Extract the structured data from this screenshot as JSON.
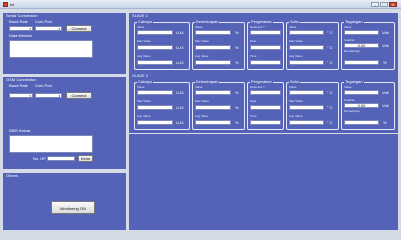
{
  "window": {
    "title": "txt",
    "btn_min": "–",
    "btn_max": "□",
    "btn_close": "x"
  },
  "serial": {
    "title": "Serial Connection",
    "baud_label": "Baud Rate",
    "com_label": "Com Port",
    "connect": "Connect",
    "data_label": "Data Mentah"
  },
  "gsm": {
    "title": "GSM Connection",
    "baud_label": "Baud Rate",
    "com_label": "Com Port",
    "connect": "Connect",
    "sms_label": "SMS Keluar",
    "no_hp_label": "No. HP",
    "send": "Kirim"
  },
  "others": {
    "title": "Others",
    "monitoring": "Monitoring ON"
  },
  "slaves": [
    {
      "title": "SLAVE 1",
      "cahaya": {
        "title": "Cahaya",
        "value": "Value",
        "max": "Max Value",
        "avg": "Avg Value",
        "unit": "LUX"
      },
      "kelembapan": {
        "title": "Kelembapan",
        "value": "Value",
        "max": "Max Value",
        "avg": "Avg Value",
        "unit": "%"
      },
      "pergerakan": {
        "title": "Pergerakan",
        "detected": "Detected ?",
        "date": "Date",
        "time": "Time"
      },
      "suhu": {
        "title": "Suhu",
        "value": "Value",
        "max": "Max Value",
        "avg": "Avg Value",
        "unit": "° C"
      },
      "tegangan": {
        "title": "Tegangan",
        "value": "Value",
        "kuadrat": "Kuadrat",
        "kuadrat_value": "0.00",
        "remaining": "Remainings",
        "unit_v": "Volt",
        "unit_pct": "%"
      }
    },
    {
      "title": "SLAVE 2",
      "cahaya": {
        "title": "Cahaya",
        "value": "Value",
        "max": "Max Value",
        "avg": "Avg Value",
        "unit": "LUX"
      },
      "kelembapan": {
        "title": "Kelembapan",
        "value": "Value",
        "max": "Max Value",
        "avg": "Avg Value",
        "unit": "%"
      },
      "pergerakan": {
        "title": "Pergerakan",
        "detected": "Detected ?",
        "date": "Date",
        "time": "Time"
      },
      "suhu": {
        "title": "Suhu",
        "value": "Value",
        "max": "Max Value",
        "avg": "Avg Value",
        "unit": "° C"
      },
      "tegangan": {
        "title": "Tegangan",
        "value": "Value",
        "kuadrat": "Kuadrat",
        "kuadrat_value": "0.00",
        "remaining": "Remainings",
        "unit_v": "Volt",
        "unit_pct": "%"
      }
    }
  ]
}
